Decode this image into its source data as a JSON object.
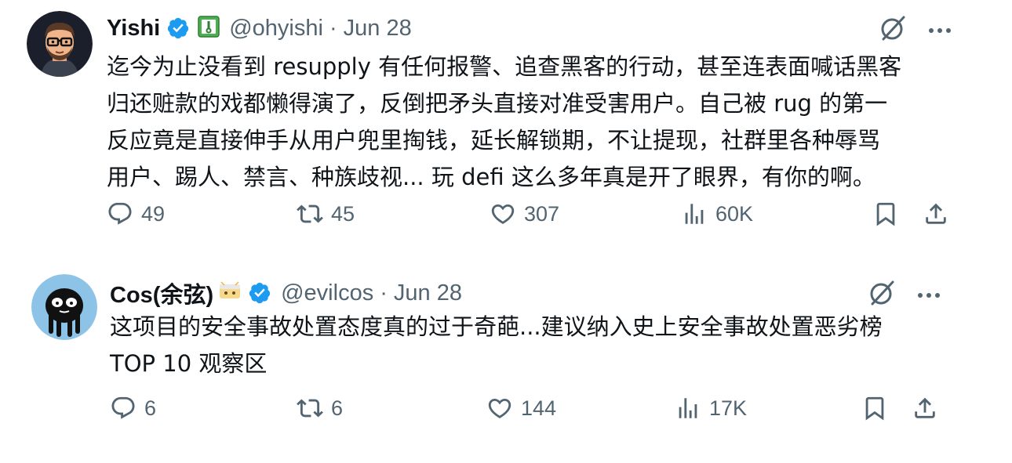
{
  "colors": {
    "text_primary": "#0f1419",
    "text_secondary": "#536471",
    "verified_blue": "#1d9bf0",
    "background": "#ffffff"
  },
  "tweets": [
    {
      "name": "Yishi",
      "verified": true,
      "badge": "green-tag-icon",
      "handle": "@ohyishi",
      "separator": "·",
      "date": "Jun 28",
      "text": "迄今为止没看到 resupply 有任何报警、追查黑客的行动，甚至连表面喊话黑客\n归还赃款的戏都懒得演了，反倒把矛头直接对准受害用户。自己被 rug 的第一\n反应竟是直接伸手从用户兜里掏钱，延长解锁期，不让提现，社群里各种辱骂\n用户、踢人、禁言、种族歧视... 玩 defi 这么多年真是开了眼界，有你的啊。",
      "replies": "49",
      "reposts": "45",
      "likes": "307",
      "views": "60K"
    },
    {
      "name": "Cos(余弦)",
      "verified": true,
      "badge": "emoji-face-icon",
      "handle": "@evilcos",
      "separator": "·",
      "date": "Jun 28",
      "text": "这项目的安全事故处置态度真的过于奇葩...建议纳入史上安全事故处置恶劣榜\nTOP 10 观察区",
      "replies": "6",
      "reposts": "6",
      "likes": "144",
      "views": "17K"
    }
  ]
}
